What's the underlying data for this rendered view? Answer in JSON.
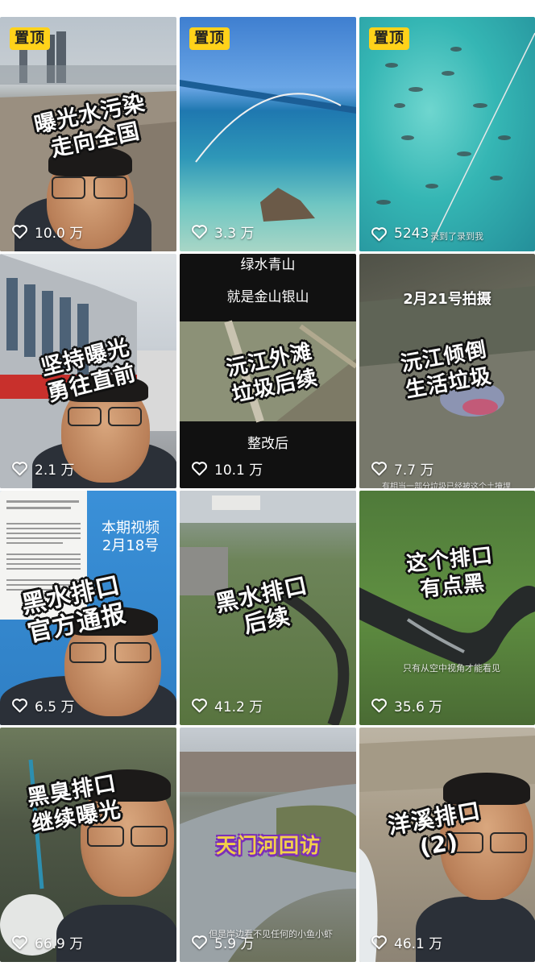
{
  "videos": [
    {
      "pinned": "置顶",
      "caption": "曝光水污染\n走向全国",
      "likes": "10.0 万",
      "sub": ""
    },
    {
      "pinned": "置顶",
      "caption": "",
      "likes": "3.3 万",
      "sub": ""
    },
    {
      "pinned": "置顶",
      "caption": "",
      "likes": "5243",
      "sub": "录到了录到我"
    },
    {
      "pinned": "",
      "caption": "坚持曝光\n勇往直前",
      "likes": "2.1 万",
      "sub": ""
    },
    {
      "pinned": "",
      "top_text": "绿水青山\n\n就是金山银山",
      "caption": "沅江外滩\n垃圾后续",
      "bottom_text": "整改后",
      "likes": "10.1 万",
      "sub": ""
    },
    {
      "pinned": "",
      "top_text": "2月21号拍摄",
      "caption": "沅江倾倒\n生活垃圾",
      "likes": "7.7 万",
      "sub": "有相当一部分垃圾已经被这个土掩埋"
    },
    {
      "pinned": "",
      "top_text": "本期视频\n2月18号",
      "caption": "黑水排口\n官方通报",
      "likes": "6.5 万",
      "sub": ""
    },
    {
      "pinned": "",
      "caption": "黑水排口\n后续",
      "likes": "41.2 万",
      "sub": ""
    },
    {
      "pinned": "",
      "caption": "这个排口\n有点黑",
      "likes": "35.6 万",
      "sub": "只有从空中视角才能看见"
    },
    {
      "pinned": "",
      "caption": "黑臭排口\n继续曝光",
      "likes": "66.9 万",
      "sub": ""
    },
    {
      "pinned": "",
      "caption": "天门河回访",
      "likes": "5.9 万",
      "sub": "但是岸边看不见任何的小鱼小虾"
    },
    {
      "pinned": "",
      "caption": "洋溪排口\n(2)",
      "likes": "46.1 万",
      "sub": ""
    }
  ],
  "colors": {
    "pin": "#ffd21a",
    "like_text": "#ffffff"
  },
  "icons": {
    "like": "heart-outline-icon"
  }
}
